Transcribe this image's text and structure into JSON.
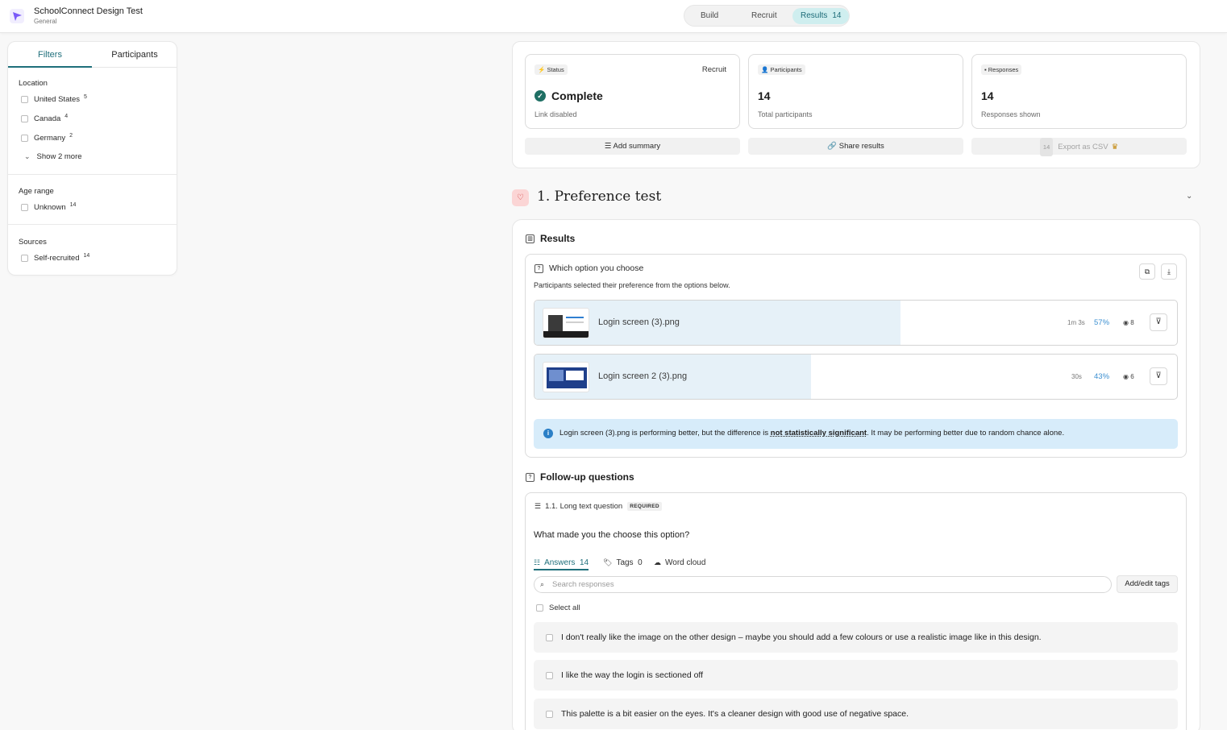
{
  "app": {
    "project_title": "SchoolConnect Design Test",
    "project_subtitle": "General",
    "brand_color": "#7a5af8"
  },
  "nav": {
    "tabs": [
      {
        "label": "Build"
      },
      {
        "label": "Recruit"
      },
      {
        "label": "Results",
        "count": "14",
        "active": true
      }
    ]
  },
  "sidebar": {
    "tabs": [
      {
        "label": "Filters",
        "active": true
      },
      {
        "label": "Participants"
      }
    ],
    "location": {
      "heading": "Location",
      "items": [
        {
          "label": "United States",
          "count": "5"
        },
        {
          "label": "Canada",
          "count": "4"
        },
        {
          "label": "Germany",
          "count": "2"
        }
      ],
      "show_more": "Show 2 more"
    },
    "age_range": {
      "heading": "Age range",
      "items": [
        {
          "label": "Unknown",
          "count": "14"
        }
      ]
    },
    "sources": {
      "heading": "Sources",
      "items": [
        {
          "label": "Self-recruited",
          "count": "14"
        }
      ]
    }
  },
  "overview": {
    "status": {
      "badge": "Status",
      "link": "Recruit",
      "value": "Complete",
      "note": "Link disabled"
    },
    "participants": {
      "badge": "Participants",
      "value": "14",
      "note": "Total participants"
    },
    "responses": {
      "badge": "Responses",
      "value": "14",
      "note": "Responses shown"
    },
    "actions": {
      "add_summary": "Add summary",
      "share_results": "Share results",
      "export_count": "14",
      "export_csv": "Export as CSV"
    }
  },
  "section": {
    "title": "1. Preference test",
    "results_heading": "Results",
    "question": {
      "title": "Which option you choose",
      "description": "Participants selected their preference from the options below.",
      "options": [
        {
          "label": "Login screen (3).png",
          "time": "1m 3s",
          "percent": "57%",
          "share": 0.57,
          "count": "8"
        },
        {
          "label": "Login screen 2 (3).png",
          "time": "30s",
          "percent": "43%",
          "share": 0.43,
          "count": "6"
        }
      ],
      "notice_pre": "Login screen (3).png is performing better, but the difference is ",
      "notice_strong": "not statistically significant",
      "notice_post": ". It may be performing better due to random chance alone."
    },
    "followup": {
      "heading": "Follow-up questions",
      "meta": "1.1. Long text question",
      "required": "REQUIRED",
      "question": "What made you the choose this option?",
      "tabs": {
        "answers": "Answers",
        "answers_count": "14",
        "tags": "Tags",
        "tags_count": "0",
        "word_cloud": "Word cloud"
      },
      "search_placeholder": "Search responses",
      "add_tags": "Add/edit tags",
      "select_all": "Select all",
      "responses": [
        "I don't really like the image on the other design – maybe you should add a few colours or use a realistic image like in this design.",
        "I like the way the login is sectioned off",
        "This palette is a bit easier on the eyes. It's a cleaner design with good use of negative space."
      ]
    }
  }
}
